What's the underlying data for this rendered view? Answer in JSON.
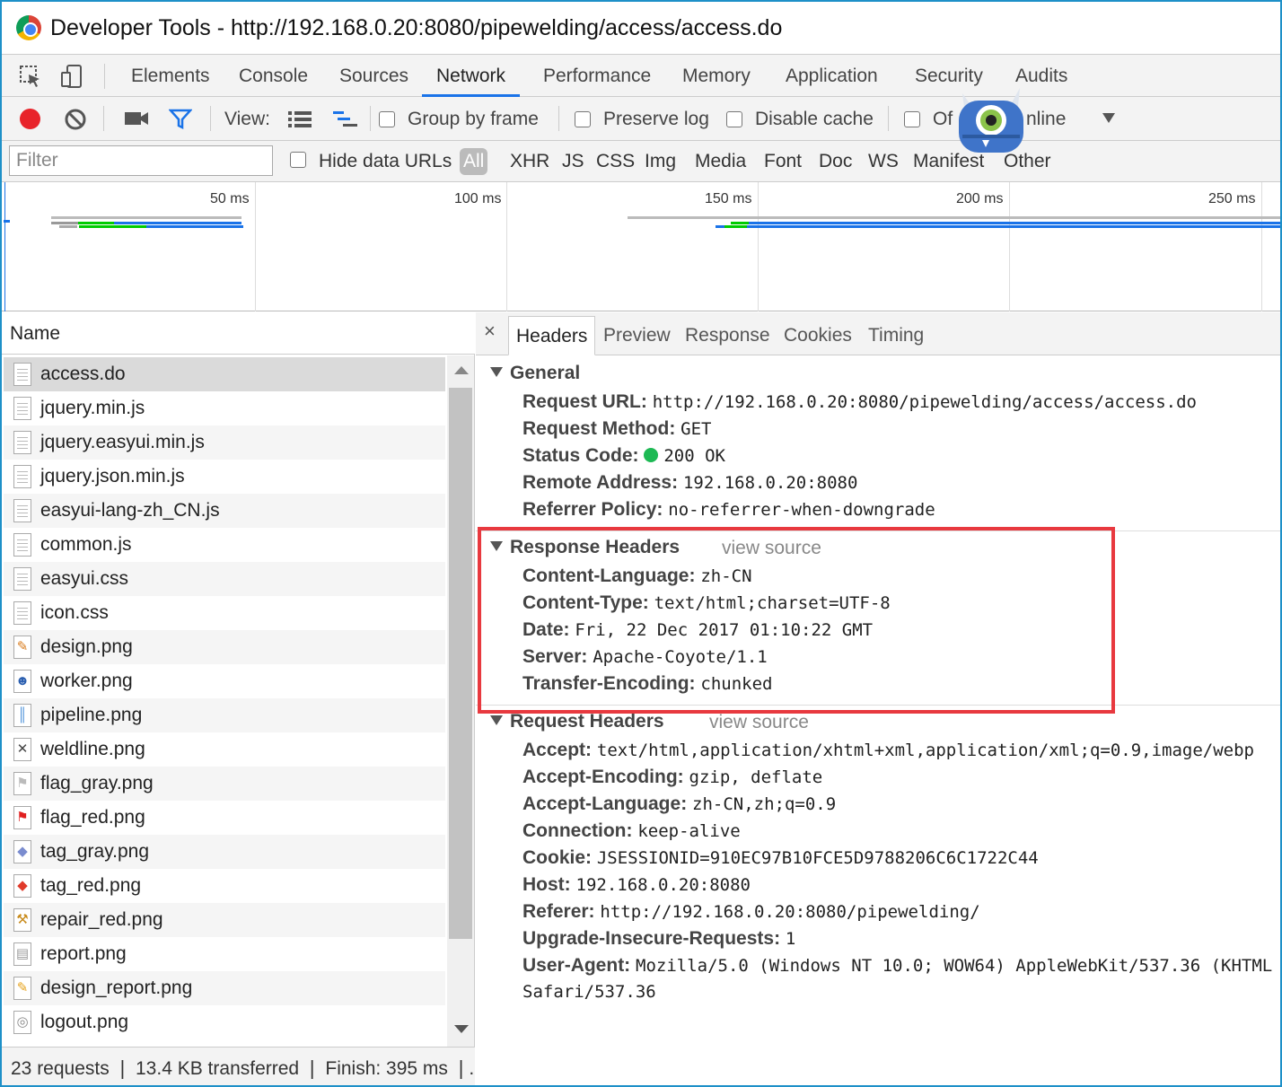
{
  "window": {
    "title": "Developer Tools - http://192.168.0.20:8080/pipewelding/access/access.do"
  },
  "tabs": [
    "Elements",
    "Console",
    "Sources",
    "Network",
    "Performance",
    "Memory",
    "Application",
    "Security",
    "Audits"
  ],
  "active_tab": "Network",
  "toolbar": {
    "view_label": "View:",
    "group_by_frame": "Group by frame",
    "preserve_log": "Preserve log",
    "disable_cache": "Disable cache",
    "offline_left": "Of",
    "offline_right": "nline",
    "record_color": "#e8232a",
    "accent_color": "#1a73e8"
  },
  "filter": {
    "placeholder": "Filter",
    "hide_data_urls": "Hide data URLs",
    "types": [
      "All",
      "XHR",
      "JS",
      "CSS",
      "Img",
      "Media",
      "Font",
      "Doc",
      "WS",
      "Manifest",
      "Other"
    ],
    "active_type": "All"
  },
  "overview": {
    "ticks": [
      "50 ms",
      "100 ms",
      "150 ms",
      "200 ms",
      "250 ms"
    ]
  },
  "requests": {
    "header": "Name",
    "files": [
      {
        "name": "access.do",
        "icon": "document-icon",
        "selected": true
      },
      {
        "name": "jquery.min.js",
        "icon": "document-icon"
      },
      {
        "name": "jquery.easyui.min.js",
        "icon": "document-icon"
      },
      {
        "name": "jquery.json.min.js",
        "icon": "document-icon"
      },
      {
        "name": "easyui-lang-zh_CN.js",
        "icon": "document-icon"
      },
      {
        "name": "common.js",
        "icon": "document-icon"
      },
      {
        "name": "easyui.css",
        "icon": "document-icon"
      },
      {
        "name": "icon.css",
        "icon": "document-icon"
      },
      {
        "name": "design.png",
        "icon": "pencil-ruler-icon"
      },
      {
        "name": "worker.png",
        "icon": "person-icon"
      },
      {
        "name": "pipeline.png",
        "icon": "pipeline-icon"
      },
      {
        "name": "weldline.png",
        "icon": "cross-tools-icon"
      },
      {
        "name": "flag_gray.png",
        "icon": "gray-flag-icon"
      },
      {
        "name": "flag_red.png",
        "icon": "red-flag-icon"
      },
      {
        "name": "tag_gray.png",
        "icon": "gray-tag-icon"
      },
      {
        "name": "tag_red.png",
        "icon": "red-tag-icon"
      },
      {
        "name": "repair_red.png",
        "icon": "wrench-icon"
      },
      {
        "name": "report.png",
        "icon": "report-icon"
      },
      {
        "name": "design_report.png",
        "icon": "pencil-icon"
      },
      {
        "name": "logout.png",
        "icon": "logout-icon"
      }
    ],
    "status": "23 requests  ❘  13.4 KB transferred  ❘  Finish: 395 ms  ❘..."
  },
  "detail": {
    "close": "×",
    "tabs": [
      "Headers",
      "Preview",
      "Response",
      "Cookies",
      "Timing"
    ],
    "active_tab": "Headers",
    "general": {
      "title": "General",
      "rows": [
        {
          "k": "Request URL:",
          "v": "http://192.168.0.20:8080/pipewelding/access/access.do"
        },
        {
          "k": "Request Method:",
          "v": "GET"
        },
        {
          "k": "Status Code:",
          "v": "200 OK",
          "status_dot": "#1db954"
        },
        {
          "k": "Remote Address:",
          "v": "192.168.0.20:8080"
        },
        {
          "k": "Referrer Policy:",
          "v": "no-referrer-when-downgrade"
        }
      ]
    },
    "response_headers": {
      "title": "Response Headers",
      "view_source": "view source",
      "rows": [
        {
          "k": "Content-Language:",
          "v": "zh-CN"
        },
        {
          "k": "Content-Type:",
          "v": "text/html;charset=UTF-8"
        },
        {
          "k": "Date:",
          "v": "Fri, 22 Dec 2017 01:10:22 GMT"
        },
        {
          "k": "Server:",
          "v": "Apache-Coyote/1.1"
        },
        {
          "k": "Transfer-Encoding:",
          "v": "chunked"
        }
      ],
      "highlight_color": "#e8393f"
    },
    "request_headers": {
      "title": "Request Headers",
      "view_source": "view source",
      "rows": [
        {
          "k": "Accept:",
          "v": "text/html,application/xhtml+xml,application/xml;q=0.9,image/webp"
        },
        {
          "k": "Accept-Encoding:",
          "v": "gzip, deflate"
        },
        {
          "k": "Accept-Language:",
          "v": "zh-CN,zh;q=0.9"
        },
        {
          "k": "Connection:",
          "v": "keep-alive"
        },
        {
          "k": "Cookie:",
          "v": "JSESSIONID=910EC97B10FCE5D9788206C6C1722C44"
        },
        {
          "k": "Host:",
          "v": "192.168.0.20:8080"
        },
        {
          "k": "Referer:",
          "v": "http://192.168.0.20:8080/pipewelding/"
        },
        {
          "k": "Upgrade-Insecure-Requests:",
          "v": "1"
        },
        {
          "k": "User-Agent:",
          "v": "Mozilla/5.0 (Windows NT 10.0; WOW64) AppleWebKit/537.36 (KHTML"
        }
      ],
      "continuation": "Safari/537.36"
    }
  }
}
